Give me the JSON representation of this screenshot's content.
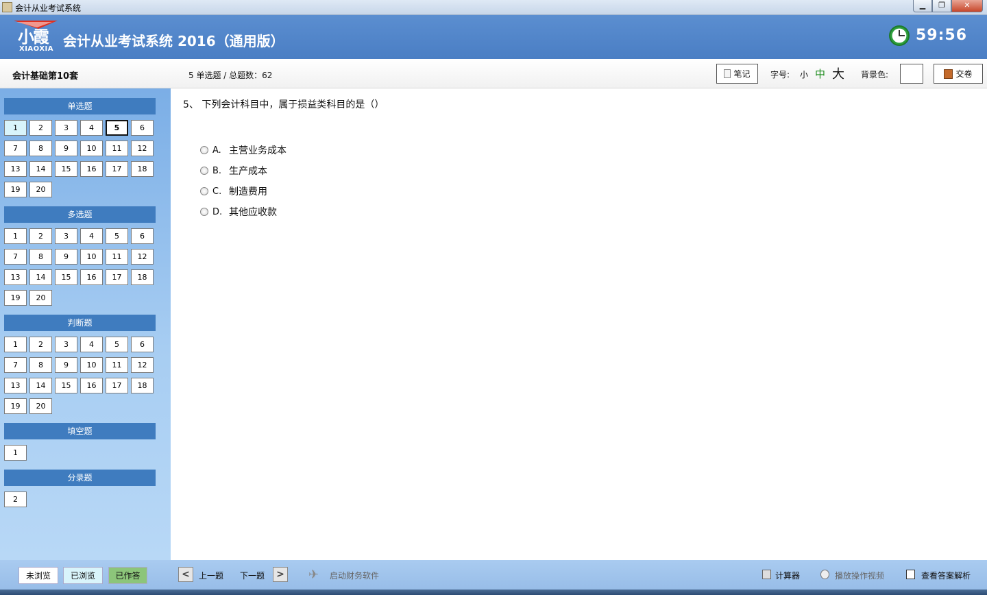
{
  "window": {
    "title": "会计从业考试系统",
    "buttons": [
      "▁",
      "❐",
      "✕"
    ]
  },
  "header": {
    "logo_mark": "小霞",
    "logo_brand": "XIAOXIA",
    "app_title": "会计从业考试系统 2016（通用版）",
    "timer": "59:56"
  },
  "infobar": {
    "set_name": "会计基础第10套",
    "progress": "5 单选题 / 总题数：62",
    "note_label": "笔记",
    "font_label": "字号:",
    "font_small": "小",
    "font_medium": "中",
    "font_large": "大",
    "bg_label": "背景色:",
    "submit_label": "交卷"
  },
  "sidebar": {
    "sections": [
      {
        "title": "单选题",
        "items": [
          "1",
          "2",
          "3",
          "4",
          "5",
          "6",
          "7",
          "8",
          "9",
          "10",
          "11",
          "12",
          "13",
          "14",
          "15",
          "16",
          "17",
          "18",
          "19",
          "20"
        ]
      },
      {
        "title": "多选题",
        "items": [
          "1",
          "2",
          "3",
          "4",
          "5",
          "6",
          "7",
          "8",
          "9",
          "10",
          "11",
          "12",
          "13",
          "14",
          "15",
          "16",
          "17",
          "18",
          "19",
          "20"
        ]
      },
      {
        "title": "判断题",
        "items": [
          "1",
          "2",
          "3",
          "4",
          "5",
          "6",
          "7",
          "8",
          "9",
          "10",
          "11",
          "12",
          "13",
          "14",
          "15",
          "16",
          "17",
          "18",
          "19",
          "20"
        ]
      },
      {
        "title": "填空题",
        "items": [
          "1"
        ]
      },
      {
        "title": "分录题",
        "items": [
          "2"
        ]
      }
    ],
    "viewed": {
      "section": 0,
      "item": 0
    },
    "current": {
      "section": 0,
      "item": 4
    }
  },
  "question": {
    "text": "5、  下列会计科目中，属于损益类科目的是（）",
    "options": [
      {
        "letter": "A.",
        "text": "主营业务成本"
      },
      {
        "letter": "B.",
        "text": "生产成本"
      },
      {
        "letter": "C.",
        "text": "制造费用"
      },
      {
        "letter": "D.",
        "text": "其他应收款"
      }
    ]
  },
  "footer": {
    "legend_unviewed": "未浏览",
    "legend_viewed": "已浏览",
    "legend_answered": "已作答",
    "prev_label": "上一题",
    "next_label": "下一题",
    "finance_software": "启动财务软件",
    "calculator": "计算器",
    "play_video": "播放操作视频",
    "view_analysis": "查看答案解析"
  },
  "colors": {
    "header": "#4a7ec4",
    "section_header": "#3f7cbf",
    "viewed": "#d9f4fb",
    "answered": "#8cc57a"
  }
}
